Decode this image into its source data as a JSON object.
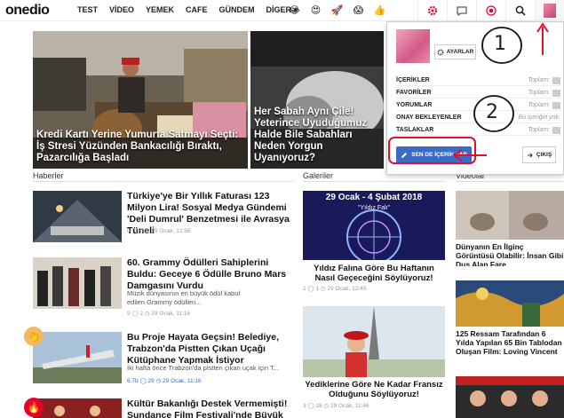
{
  "nav": {
    "logo": "onedio",
    "menu": [
      "TEST",
      "VİDEO",
      "YEMEK",
      "CAFE",
      "GÜNDEM",
      "DİGER ▾"
    ],
    "emojis": [
      "😂",
      "😍",
      "🚀",
      "😱",
      "👍"
    ],
    "icons": [
      "gear-icon",
      "chat-icon",
      "target-icon",
      "search-icon",
      "avatar"
    ]
  },
  "hero": [
    {
      "title": "Kredi Kartı Yerine Yumurta Satmayı Seçti: İş Stresi Yüzünden Bankacılığı Bıraktı, Pazarcılığa Başladı"
    },
    {
      "title": "Her Sabah Aynı Çile! Yeterince Uyuduğumuz Halde Bile Sabahları Neden Yorgun Uyanıyoruz?"
    }
  ],
  "sections": {
    "haberler": "Haberler",
    "galeriler": "Galeriler",
    "videolar": "Videolar"
  },
  "news": [
    {
      "title": "Türkiye'ye Bir Yıllık Faturası 123 Milyon Lira! Sosyal Medya Gündemi 'Deli Dumrul' Benzetmesi ile Avrasya Tüneli",
      "summary": "",
      "meta": "0  ◯ 0  ◷ 29 Ocak, 12:58"
    },
    {
      "title": "60. Grammy Ödülleri Sahiplerini Buldu: Geceye 6 Ödülle Bruno Mars Damgasını Vurdu",
      "summary": "Müzik dünyasının en büyük ödül kabul edilen Grammy ödülleri...",
      "meta": "9  ◯ 2  ◷ 29 Ocak, 11:16"
    },
    {
      "title": "Bu Proje Hayata Geçsin! Belediye, Trabzon'da Pistten Çıkan Uçağı Kütüphane Yapmak İstiyor",
      "summary": "İki hafta önce Trabzon'da pistten çıkan uçak için T...",
      "meta": "6.7b  ◯ 29  ◷ 29 Ocak, 11:16"
    },
    {
      "title": "Kültür Bakanlığı Destek Vermemişti! Sundance Film Festivali'nde Büyük Jüri",
      "summary": "",
      "meta": ""
    }
  ],
  "galleries": [
    {
      "title": "Yıldız Falına Göre Bu Haftanın Nasıl Geçeceğini Söylüyoruz!",
      "img_text": "29 Ocak - 4 Şubat 2018",
      "img_sub": "\"Yıldız Falı\"",
      "meta": "1  ◯ 1  ◷ 29 Ocak, 12:45"
    },
    {
      "title": "Yediklerine Göre Ne Kadar Fransız Olduğunu Söylüyoruz!",
      "img_text": "",
      "img_sub": "",
      "meta": "3  ◯ 28  ◷ 29 Ocak, 11:46"
    }
  ],
  "videos": [
    {
      "title": "Dünyanın En İlginç Görüntüsü Olabilir: İnsan Gibi Duş Alan Fare"
    },
    {
      "title": "125 Ressam Tarafından 6 Yılda Yapılan 65 Bin Tablodan Oluşan Film: Loving Vincent"
    },
    {
      "title": ""
    }
  ],
  "dropdown": {
    "settings_label": "AYARLAR",
    "rows": [
      {
        "label": "İÇERİKLER",
        "right": "Toplam:"
      },
      {
        "label": "FAVORİLER",
        "right": "Toplam:"
      },
      {
        "label": "YORUMLAR",
        "right": "Toplam:"
      },
      {
        "label": "ONAY BEKLEYENLER",
        "right": "Bu içeriğin yok."
      },
      {
        "label": "TASLAKLAR",
        "right": "Toplam:"
      }
    ],
    "create_label": "SEN DE İÇERİK YAP",
    "logout_label": "ÇIKIŞ"
  },
  "annotations": {
    "one": "1",
    "two": "2"
  },
  "colors": {
    "accent": "#e4032c",
    "primary_button": "#3a6cc6",
    "annotation": "#e0102a"
  }
}
